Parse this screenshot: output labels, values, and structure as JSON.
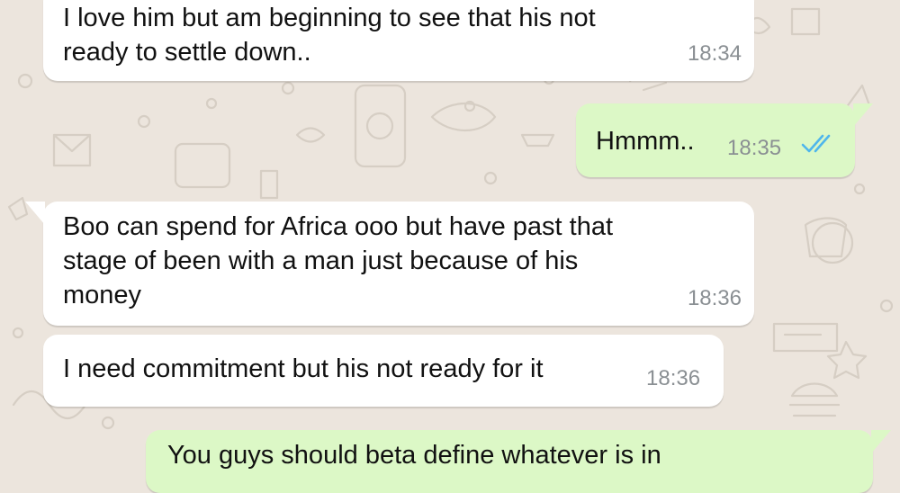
{
  "colors": {
    "wallpaper": "#ece5dd",
    "incoming_bubble": "#ffffff",
    "outgoing_bubble": "#dcf8c6",
    "timestamp": "#8a8f93",
    "read_ticks": "#4fb6ec"
  },
  "messages": [
    {
      "direction": "incoming",
      "lines": [
        "I love him but am beginning to see that his not",
        "ready to settle down.."
      ],
      "time": "18:34"
    },
    {
      "direction": "outgoing",
      "lines": [
        "Hmmm.."
      ],
      "time": "18:35",
      "status_icon": "double-check-read-icon"
    },
    {
      "direction": "incoming",
      "lines": [
        "Boo can spend for Africa ooo  but have past that",
        "stage of been with a man just because of his",
        "money"
      ],
      "time": "18:36"
    },
    {
      "direction": "incoming",
      "lines": [
        "I need commitment but his not ready for it"
      ],
      "time": "18:36"
    },
    {
      "direction": "outgoing",
      "lines": [
        "You guys should beta define whatever is in"
      ]
    }
  ]
}
